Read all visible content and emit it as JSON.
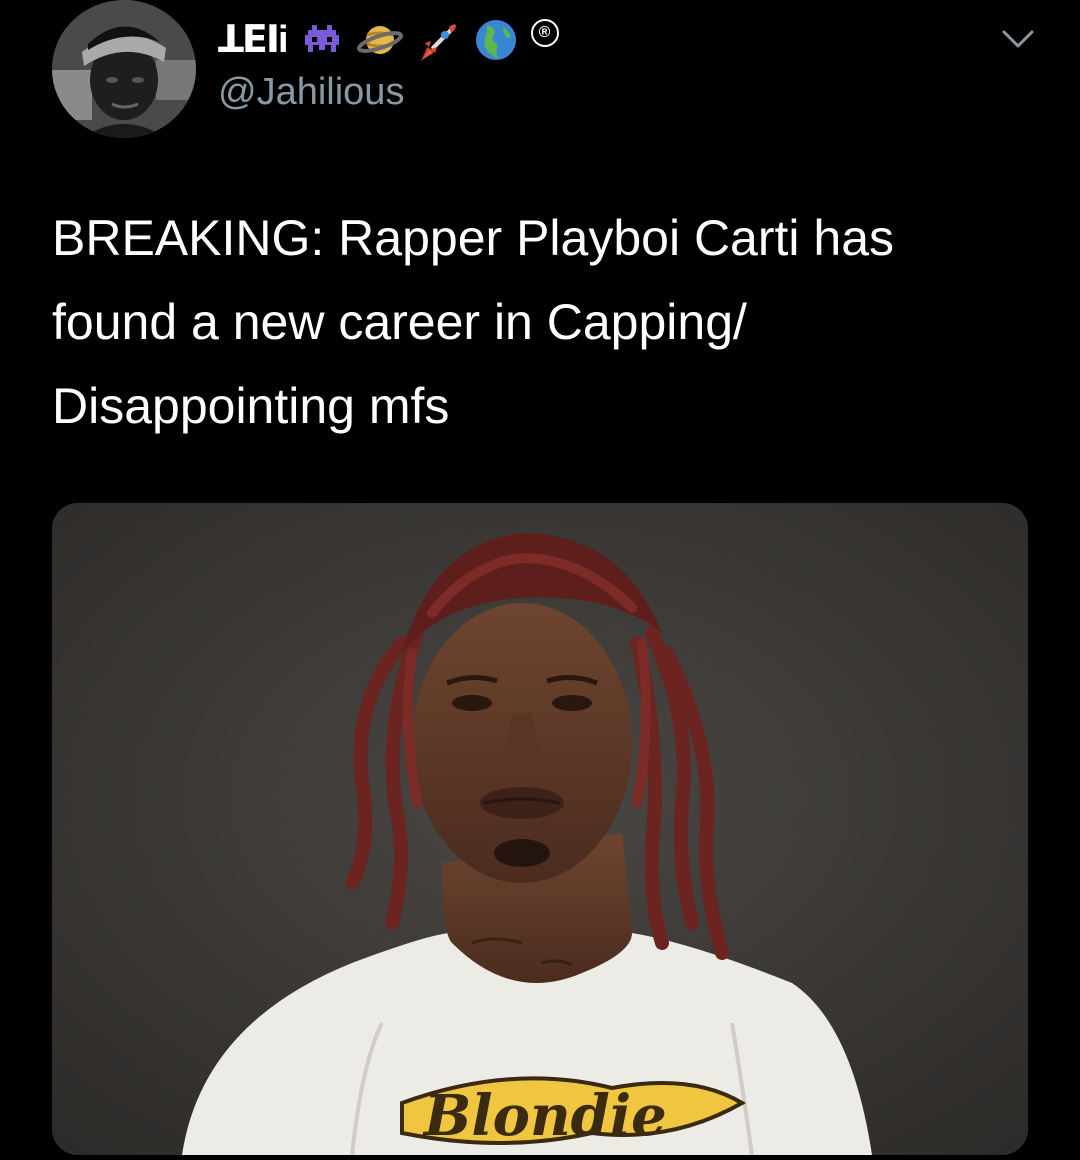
{
  "tweet": {
    "author": {
      "display_name": "ꓕꓰꓲi",
      "emoji_icons": [
        "alien-monster-icon",
        "ringed-planet-icon",
        "rocket-icon",
        "globe-americas-icon"
      ],
      "registered_mark": "®",
      "handle": "@Jahilious"
    },
    "menu_icon": "chevron-down-icon",
    "text_lines": [
      "BREAKING: Rapper Playboi Carti has",
      "found a new career in Capping/",
      "Disappointing mfs"
    ],
    "media": {
      "shirt_text": "Blondie"
    }
  },
  "colors": {
    "background": "#000000",
    "text_primary": "#ffffff",
    "text_secondary": "#8899a6",
    "media_background": "#3e3b38"
  }
}
